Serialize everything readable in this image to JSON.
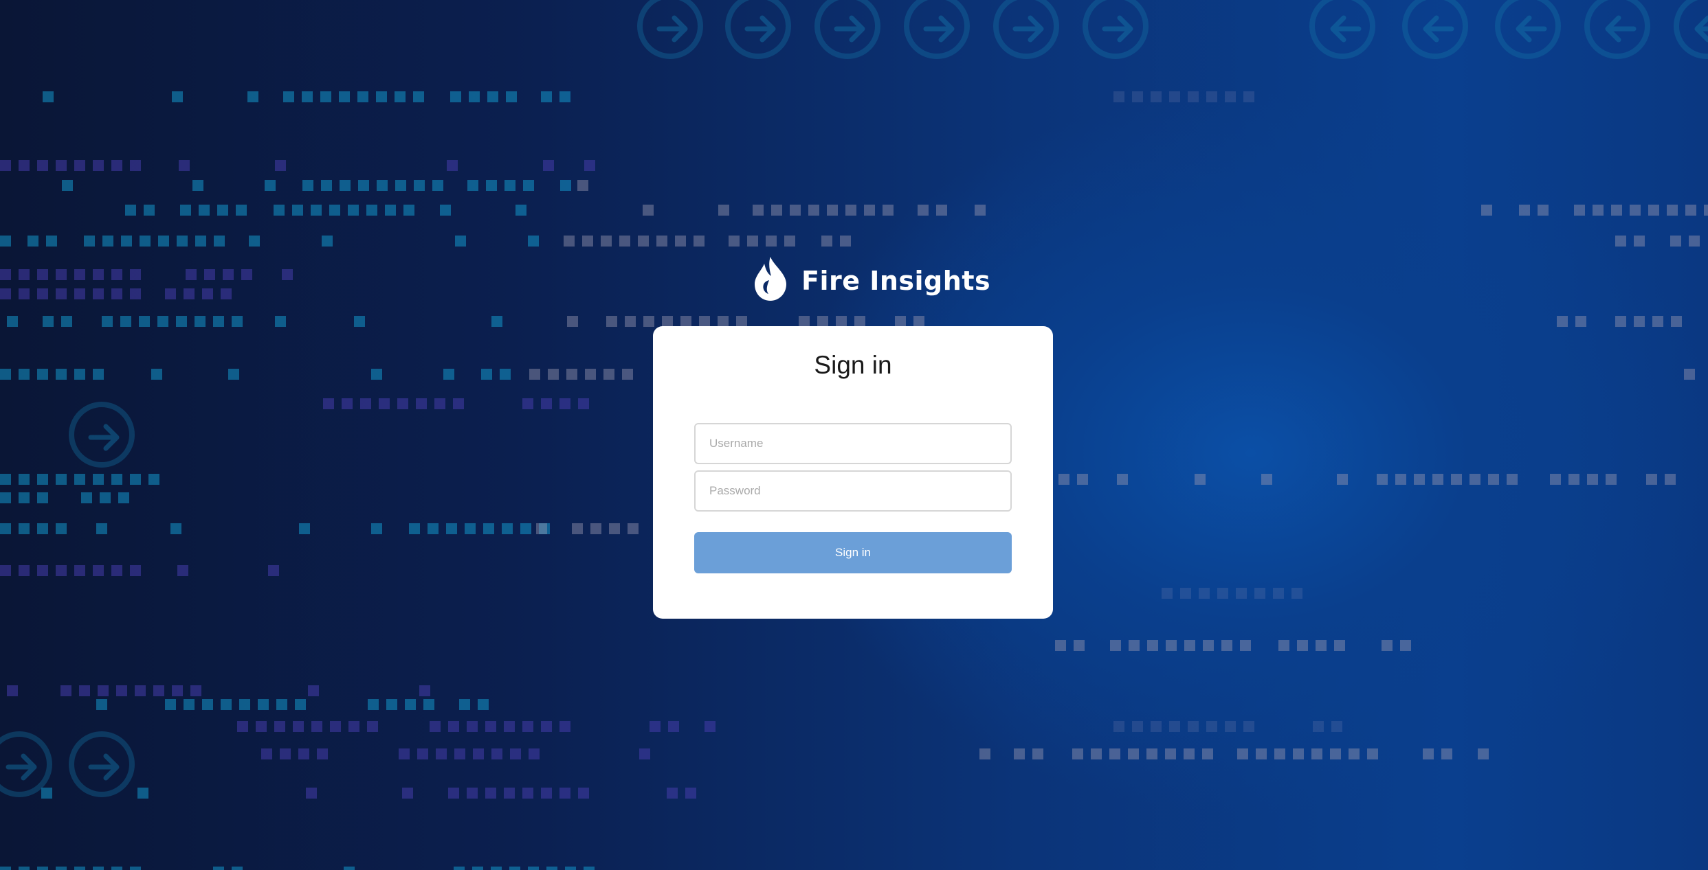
{
  "brand": {
    "name": "Fire Insights",
    "logo_icon": "flame-icon"
  },
  "login": {
    "title": "Sign in",
    "username_placeholder": "Username",
    "username_value": "",
    "password_placeholder": "Password",
    "password_value": "",
    "submit_label": "Sign in",
    "submit_color": "#6b9fd8"
  },
  "background": {
    "theme": "tech-circuit",
    "colors": [
      "#0a1636",
      "#0b3479",
      "#0a3f8e"
    ]
  }
}
